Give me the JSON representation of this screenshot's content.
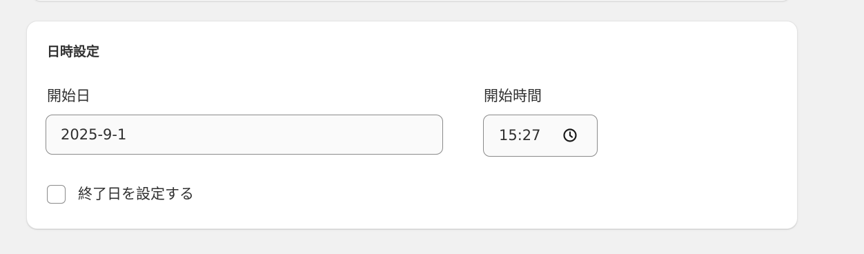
{
  "section": {
    "title": "日時設定"
  },
  "start_date": {
    "label": "開始日",
    "value": "2025-9-1"
  },
  "start_time": {
    "label": "開始時間",
    "value": "15:27",
    "icon": "clock-icon"
  },
  "end_date_toggle": {
    "label": "終了日を設定する",
    "checked": false
  }
}
